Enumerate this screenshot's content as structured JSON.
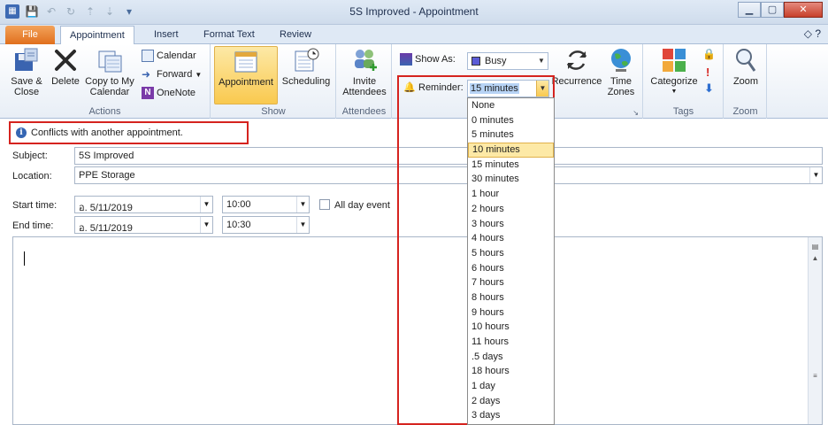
{
  "window": {
    "title": "5S Improved  -  Appointment"
  },
  "tabs": [
    "File",
    "Appointment",
    "Insert",
    "Format Text",
    "Review"
  ],
  "ribbon": {
    "actions": {
      "save_close": "Save &\nClose",
      "delete": "Delete",
      "copy_to_calendar": "Copy to My\nCalendar",
      "calendar": "Calendar",
      "forward": "Forward",
      "onenote": "OneNote",
      "label": "Actions"
    },
    "show": {
      "appointment": "Appointment",
      "scheduling": "Scheduling",
      "label": "Show"
    },
    "attendees": {
      "invite": "Invite\nAttendees",
      "label": "Attendees"
    },
    "options": {
      "show_as_label": "Show As:",
      "show_as_value": "Busy",
      "reminder_label": "Reminder:",
      "reminder_value": "15 minutes",
      "recurrence": "Recurrence",
      "time_zones": "Time\nZones"
    },
    "tags": {
      "categorize": "Categorize",
      "label": "Tags"
    },
    "zoom": {
      "zoom": "Zoom",
      "label": "Zoom"
    }
  },
  "infobar": {
    "message": "Conflicts with another appointment."
  },
  "form": {
    "subject_label": "Subject:",
    "subject_value": "5S Improved",
    "location_label": "Location:",
    "location_value": "PPE Storage",
    "start_label": "Start time:",
    "start_date": "อ. 5/11/2019",
    "start_time": "10:00",
    "all_day_label": "All day event",
    "end_label": "End time:",
    "end_date": "อ. 5/11/2019",
    "end_time": "10:30"
  },
  "reminder_options": [
    "None",
    "0 minutes",
    "5 minutes",
    "10 minutes",
    "15 minutes",
    "30 minutes",
    "1 hour",
    "2 hours",
    "3 hours",
    "4 hours",
    "5 hours",
    "6 hours",
    "7 hours",
    "8 hours",
    "9 hours",
    "10 hours",
    "11 hours",
    ".5 days",
    "18 hours",
    "1 day",
    "2 days",
    "3 days"
  ],
  "reminder_highlighted": "10 minutes",
  "colors": {
    "accent_red": "#d5231f",
    "file_tab": "#e06f1d",
    "highlight": "#fde9a6"
  }
}
